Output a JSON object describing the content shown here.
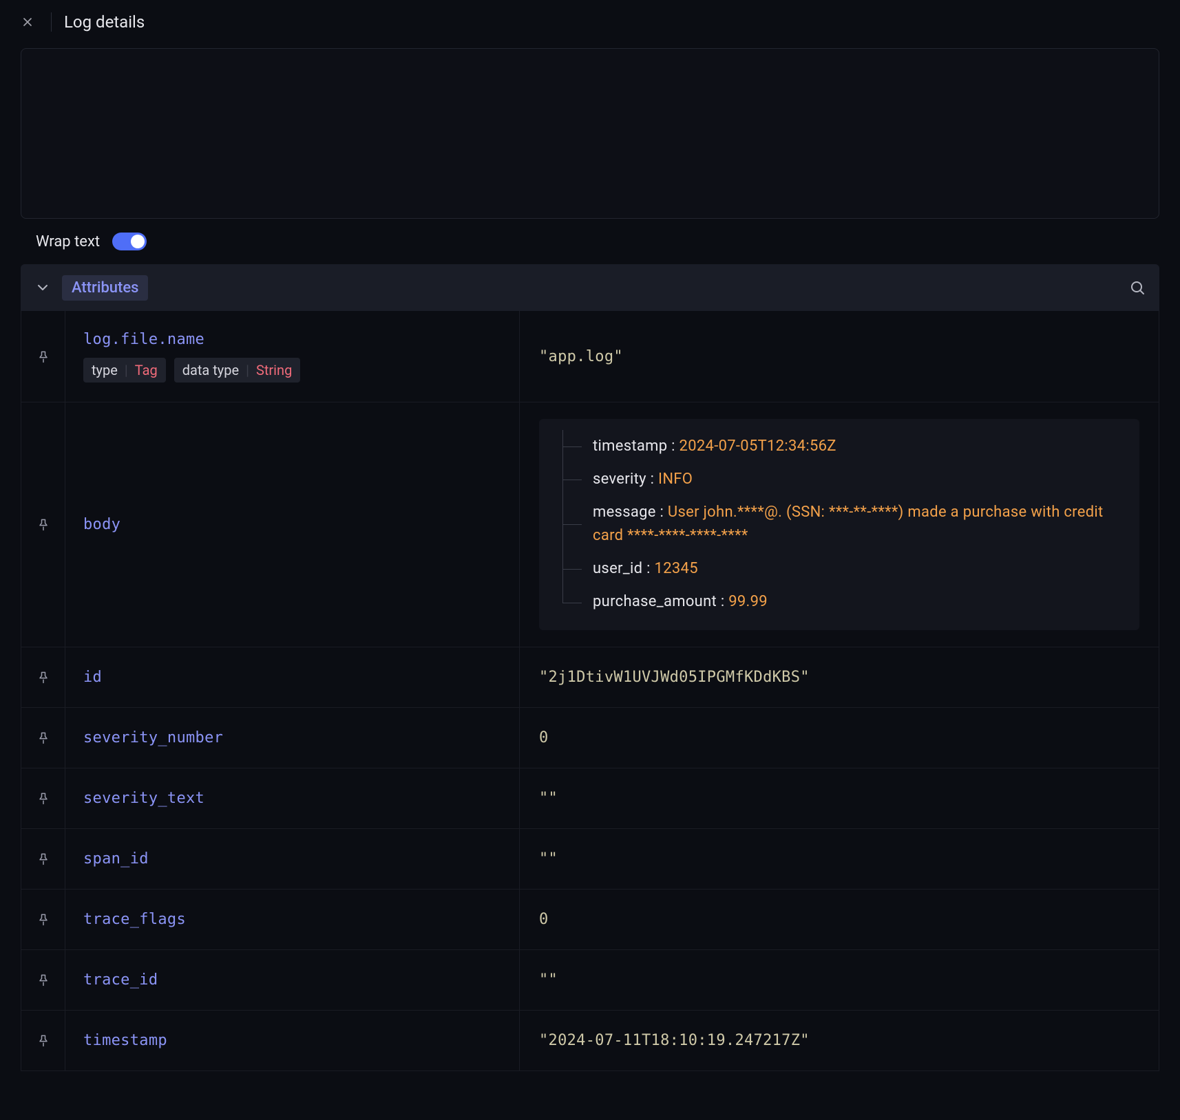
{
  "header": {
    "title": "Log details"
  },
  "wrap": {
    "label": "Wrap text",
    "on": true
  },
  "section": {
    "label": "Attributes"
  },
  "pins": {
    "label": "pin"
  },
  "meta": {
    "type_label": "type",
    "type_value": "Tag",
    "dt_label": "data type",
    "dt_value": "String"
  },
  "rows": {
    "logfilename": {
      "key": "log.file.name",
      "value": "\"app.log\""
    },
    "body": {
      "key": "body",
      "tree": [
        {
          "k": "timestamp",
          "v": "2024-07-05T12:34:56Z"
        },
        {
          "k": "severity",
          "v": "INFO"
        },
        {
          "k": "message",
          "v": "User john.****@. (SSN: ***-**-****) made a purchase with credit card ****-****-****-****"
        },
        {
          "k": "user_id",
          "v": "12345"
        },
        {
          "k": "purchase_amount",
          "v": "99.99"
        }
      ]
    },
    "id": {
      "key": "id",
      "value": "\"2j1DtivW1UVJWd05IPGMfKDdKBS\""
    },
    "severity_number": {
      "key": "severity_number",
      "value": "0"
    },
    "severity_text": {
      "key": "severity_text",
      "value": "\"\""
    },
    "span_id": {
      "key": "span_id",
      "value": "\"\""
    },
    "trace_flags": {
      "key": "trace_flags",
      "value": "0"
    },
    "trace_id": {
      "key": "trace_id",
      "value": "\"\""
    },
    "timestamp": {
      "key": "timestamp",
      "value": "\"2024-07-11T18:10:19.247217Z\""
    }
  }
}
